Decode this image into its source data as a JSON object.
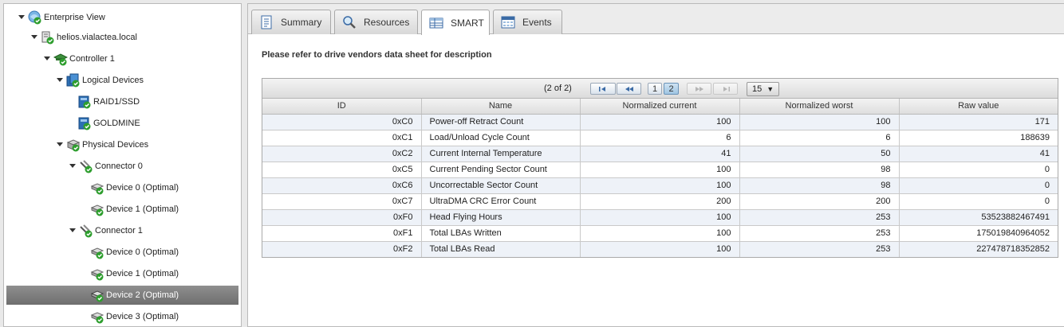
{
  "tree": {
    "nodes": [
      {
        "label": "Enterprise View",
        "icon": "enterprise-icon",
        "expanded": true
      },
      {
        "label": "helios.vialactea.local",
        "icon": "server-icon",
        "expanded": true
      },
      {
        "label": "Controller 1",
        "icon": "controller-icon",
        "expanded": true
      },
      {
        "label": "Logical Devices",
        "icon": "logical-devices-icon",
        "expanded": true
      },
      {
        "label": "RAID1/SSD",
        "icon": "logical-drive-icon"
      },
      {
        "label": "GOLDMINE",
        "icon": "logical-drive-icon"
      },
      {
        "label": "Physical Devices",
        "icon": "physical-devices-icon",
        "expanded": true
      },
      {
        "label": "Connector 0",
        "icon": "connector-icon",
        "expanded": true
      },
      {
        "label": "Device 0 (Optimal)",
        "icon": "disk-icon"
      },
      {
        "label": "Device 1 (Optimal)",
        "icon": "disk-icon"
      },
      {
        "label": "Connector 1",
        "icon": "connector-icon",
        "expanded": true
      },
      {
        "label": "Device 0 (Optimal)",
        "icon": "disk-icon"
      },
      {
        "label": "Device 1 (Optimal)",
        "icon": "disk-icon"
      },
      {
        "label": "Device 2 (Optimal)",
        "icon": "disk-icon",
        "selected": true
      },
      {
        "label": "Device 3 (Optimal)",
        "icon": "disk-icon"
      }
    ]
  },
  "tabs": [
    {
      "label": "Summary",
      "icon": "summary-icon"
    },
    {
      "label": "Resources",
      "icon": "magnifier-icon"
    },
    {
      "label": "SMART",
      "icon": "table-icon",
      "active": true
    },
    {
      "label": "Events",
      "icon": "calendar-icon"
    }
  ],
  "note": "Please refer to drive vendors data sheet for description",
  "pager": {
    "info": "(2 of 2)",
    "pages": [
      "1",
      "2"
    ],
    "current_page": "2",
    "page_size": "15"
  },
  "columns": [
    "ID",
    "Name",
    "Normalized current",
    "Normalized worst",
    "Raw value"
  ],
  "rows": [
    {
      "id": "0xC0",
      "name": "Power-off Retract Count",
      "current": "100",
      "worst": "100",
      "raw": "171"
    },
    {
      "id": "0xC1",
      "name": "Load/Unload Cycle Count",
      "current": "6",
      "worst": "6",
      "raw": "188639"
    },
    {
      "id": "0xC2",
      "name": "Current Internal Temperature",
      "current": "41",
      "worst": "50",
      "raw": "41"
    },
    {
      "id": "0xC5",
      "name": "Current Pending Sector Count",
      "current": "100",
      "worst": "98",
      "raw": "0"
    },
    {
      "id": "0xC6",
      "name": "Uncorrectable Sector Count",
      "current": "100",
      "worst": "98",
      "raw": "0"
    },
    {
      "id": "0xC7",
      "name": "UltraDMA CRC Error Count",
      "current": "200",
      "worst": "200",
      "raw": "0"
    },
    {
      "id": "0xF0",
      "name": "Head Flying Hours",
      "current": "100",
      "worst": "253",
      "raw": "53523882467491"
    },
    {
      "id": "0xF1",
      "name": "Total LBAs Written",
      "current": "100",
      "worst": "253",
      "raw": "175019840964052"
    },
    {
      "id": "0xF2",
      "name": "Total LBAs Read",
      "current": "100",
      "worst": "253",
      "raw": "227478718352852"
    }
  ],
  "colors": {
    "selected_row": "#7a7a7a",
    "odd_row": "#eef2f8",
    "check_green": "#2e9e2e",
    "drive_blue": "#2c6fb4"
  }
}
